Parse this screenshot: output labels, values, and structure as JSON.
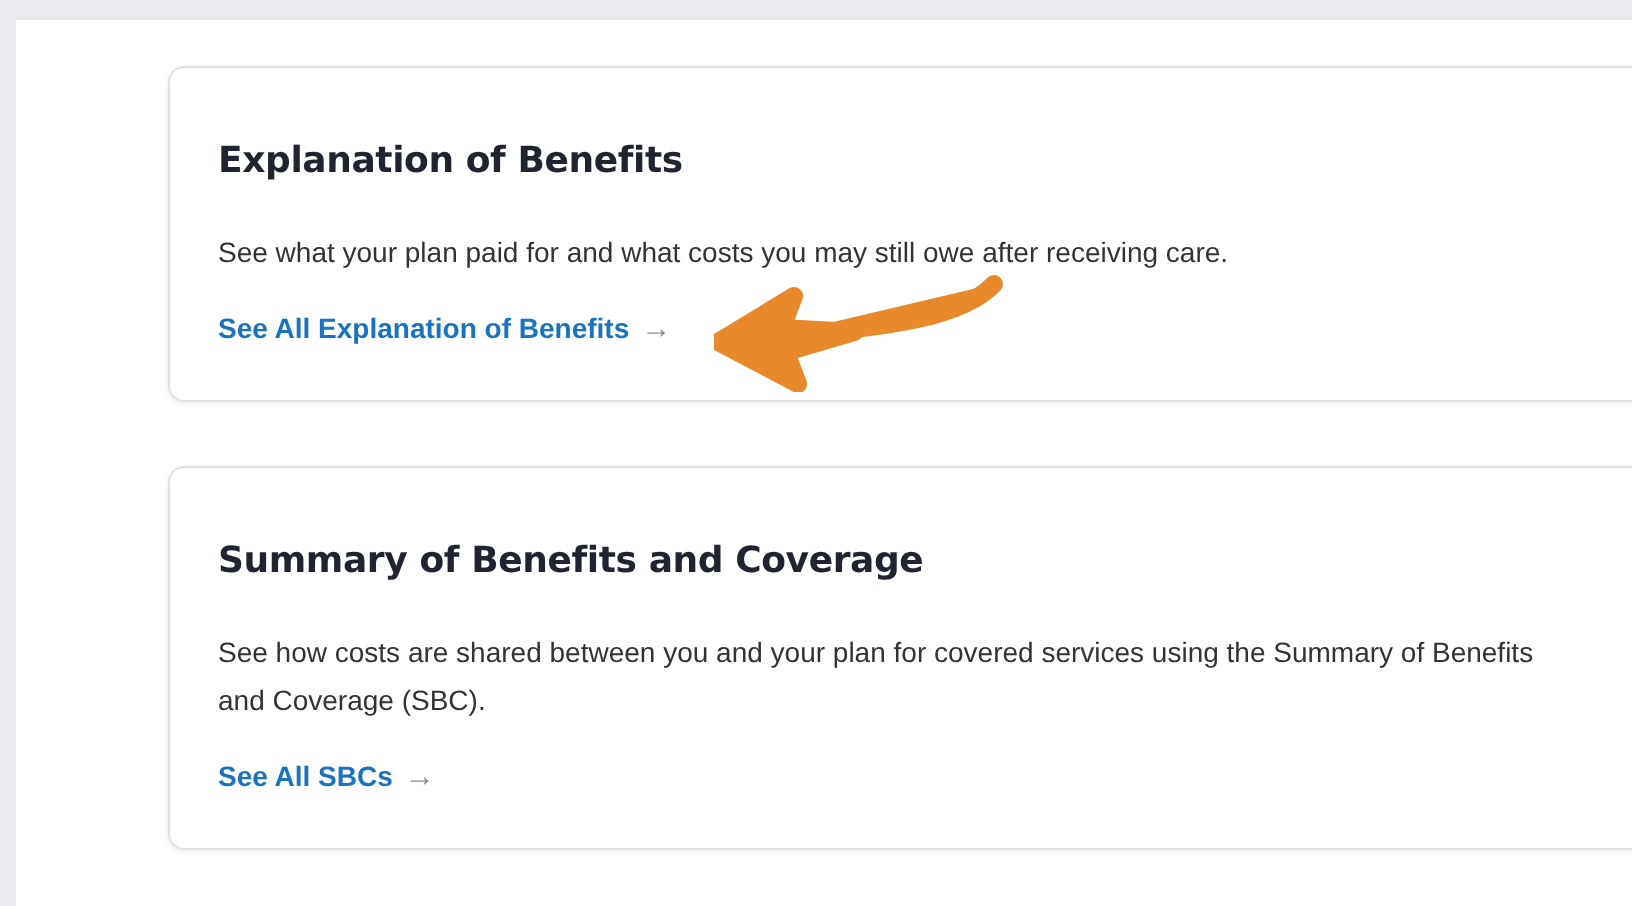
{
  "cards": [
    {
      "title": "Explanation of Benefits",
      "text": "See what your plan paid for and what costs you may still owe after receiving care.",
      "link": "See All Explanation of Benefits",
      "link_arrow": "→",
      "annotation_arrow": true
    },
    {
      "title": "Summary of Benefits and Coverage",
      "text": "See how costs are shared between you and your plan for covered services using the Summary of Benefits and Coverage (SBC).",
      "link": "See All SBCs",
      "link_arrow": "→",
      "annotation_arrow": false
    }
  ]
}
